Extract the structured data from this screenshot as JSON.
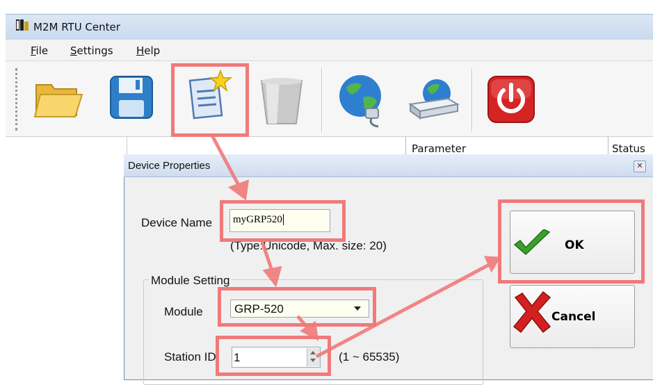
{
  "window": {
    "title": "M2M RTU Center"
  },
  "menu": [
    {
      "label": "File",
      "mnemonic": "F"
    },
    {
      "label": "Settings",
      "mnemonic": "S"
    },
    {
      "label": "Help",
      "mnemonic": "H"
    }
  ],
  "toolbar": {
    "buttons": [
      {
        "icon": "open-folder-icon"
      },
      {
        "icon": "save-floppy-icon"
      },
      {
        "icon": "new-device-icon"
      },
      {
        "icon": "delete-icon"
      },
      {
        "icon": "network-connect-icon"
      },
      {
        "icon": "server-network-icon"
      },
      {
        "icon": "power-exit-icon"
      }
    ]
  },
  "grid": {
    "headers": [
      "Parameter",
      "Status"
    ]
  },
  "dialog": {
    "title": "Device Properties",
    "device_name_label": "Device Name",
    "device_name_value": "myGRP520",
    "device_name_hint": "(Type:Unicode, Max. size: 20)",
    "module_group_label": "Module Setting",
    "module_label": "Module",
    "module_value": "GRP-520",
    "station_label": "Station ID",
    "station_value": "1",
    "station_range": "(1 ~ 65535)",
    "ok_label": "OK",
    "cancel_label": "Cancel"
  },
  "colors": {
    "highlight": "#f07a7a",
    "ok_check": "#3aa02c",
    "cancel_x": "#d42020"
  }
}
